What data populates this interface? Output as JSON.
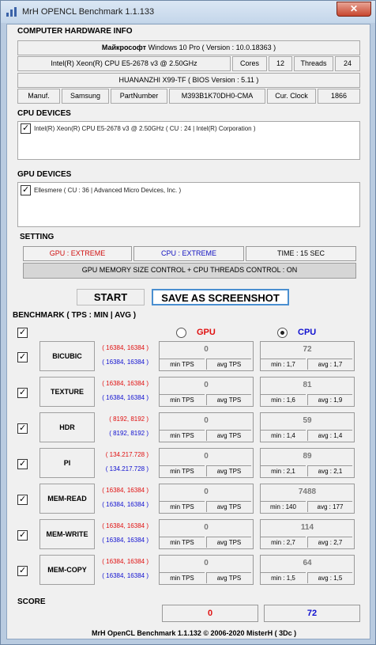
{
  "window": {
    "title": "MrH OPENCL Benchmark 1.1.133",
    "close_glyph": "✕"
  },
  "hardware": {
    "heading": "COMPUTER HARDWARE INFO",
    "os_maker": "Майкрософт",
    "os": "Windows 10 Pro ( Version : 10.0.18363 )",
    "cpu": "Intel(R) Xeon(R) CPU E5-2678 v3 @ 2.50GHz",
    "cores_label": "Cores",
    "cores": "12",
    "threads_label": "Threads",
    "threads": "24",
    "board": "HUANANZHI X99-TF ( BIOS Version : 5.11 )",
    "manuf_label": "Manuf.",
    "manuf": "Samsung",
    "part_label": "PartNumber",
    "part": "M393B1K70DH0-CMA",
    "clock_label": "Cur. Clock",
    "clock": "1866"
  },
  "cpu_devices": {
    "heading": "CPU DEVICES",
    "item": "Intel(R) Xeon(R) CPU E5-2678 v3 @ 2.50GHz ( CU : 24 | Intel(R) Corporation )"
  },
  "gpu_devices": {
    "heading": "GPU DEVICES",
    "item": "Ellesmere ( CU : 36 | Advanced Micro Devices, Inc. )"
  },
  "setting": {
    "heading": "SETTING",
    "gpu": "GPU : EXTREME",
    "cpu": "CPU : EXTREME",
    "time": "TIME : 15 SEC",
    "control": "GPU MEMORY SIZE CONTROL + CPU THREADS CONTROL : ON"
  },
  "buttons": {
    "start": "START",
    "screenshot": "SAVE AS SCREENSHOT"
  },
  "bench_heading": "BENCHMARK ( TPS : MIN | AVG )",
  "radio": {
    "gpu": "GPU",
    "cpu": "CPU"
  },
  "colors": {
    "gpu": "#e01010",
    "cpu": "#1010d0"
  },
  "rows": [
    {
      "name": "BICUBIC",
      "gpu_res": "( 16384, 16384 )",
      "cpu_res": "( 16384, 16384 )",
      "gpu_tps": "0",
      "gpu_min": "min TPS",
      "gpu_avg": "avg TPS",
      "cpu_tps": "72",
      "cpu_min": "min : 1,7",
      "cpu_avg": "avg : 1,7"
    },
    {
      "name": "TEXTURE",
      "gpu_res": "( 16384, 16384 )",
      "cpu_res": "( 16384, 16384 )",
      "gpu_tps": "0",
      "gpu_min": "min TPS",
      "gpu_avg": "avg TPS",
      "cpu_tps": "81",
      "cpu_min": "min : 1,6",
      "cpu_avg": "avg : 1,9"
    },
    {
      "name": "HDR",
      "gpu_res": "( 8192, 8192 )",
      "cpu_res": "( 8192, 8192 )",
      "gpu_tps": "0",
      "gpu_min": "min TPS",
      "gpu_avg": "avg TPS",
      "cpu_tps": "59",
      "cpu_min": "min : 1,4",
      "cpu_avg": "avg : 1,4"
    },
    {
      "name": "PI",
      "gpu_res": "( 134.217.728 )",
      "cpu_res": "( 134.217.728 )",
      "gpu_tps": "0",
      "gpu_min": "min TPS",
      "gpu_avg": "avg TPS",
      "cpu_tps": "89",
      "cpu_min": "min : 2,1",
      "cpu_avg": "avg : 2,1"
    },
    {
      "name": "MEM-READ",
      "gpu_res": "( 16384, 16384 )",
      "cpu_res": "( 16384, 16384 )",
      "gpu_tps": "0",
      "gpu_min": "min TPS",
      "gpu_avg": "avg TPS",
      "cpu_tps": "7488",
      "cpu_min": "min : 140",
      "cpu_avg": "avg : 177"
    },
    {
      "name": "MEM-WRITE",
      "gpu_res": "( 16384, 16384 )",
      "cpu_res": "( 16384, 16384 )",
      "gpu_tps": "0",
      "gpu_min": "min TPS",
      "gpu_avg": "avg TPS",
      "cpu_tps": "114",
      "cpu_min": "min : 2,7",
      "cpu_avg": "avg : 2,7"
    },
    {
      "name": "MEM-COPY",
      "gpu_res": "( 16384, 16384 )",
      "cpu_res": "( 16384, 16384 )",
      "gpu_tps": "0",
      "gpu_min": "min TPS",
      "gpu_avg": "avg TPS",
      "cpu_tps": "64",
      "cpu_min": "min : 1,5",
      "cpu_avg": "avg : 1,5"
    }
  ],
  "score": {
    "label": "SCORE",
    "gpu": "0",
    "cpu": "72"
  },
  "footer": "MrH OpenCL Benchmark 1.1.132 © 2006-2020 MisterH ( 3Dc )"
}
